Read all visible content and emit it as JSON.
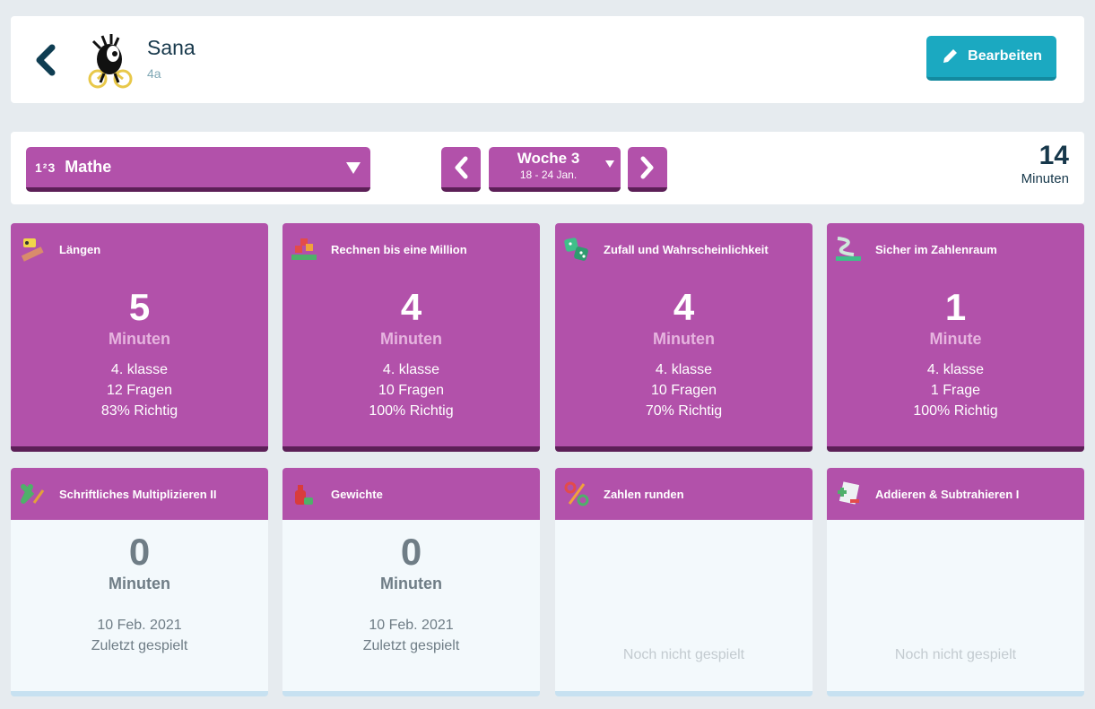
{
  "header": {
    "name": "Sana",
    "class": "4a",
    "edit_label": "Bearbeiten"
  },
  "filter": {
    "subject": "Mathe",
    "subject_icon_text": "1²3",
    "week_title": "Woche 3",
    "week_range": "18 - 24 Jan.",
    "total_minutes": "14",
    "total_unit": "Minuten"
  },
  "tiles_active": [
    {
      "title": "Längen",
      "minutes": "5",
      "unit": "Minuten",
      "grade": "4. klasse",
      "questions": "12 Fragen",
      "correct": "83% Richtig"
    },
    {
      "title": "Rechnen bis eine Million",
      "minutes": "4",
      "unit": "Minuten",
      "grade": "4. klasse",
      "questions": "10 Fragen",
      "correct": "100% Richtig"
    },
    {
      "title": "Zufall und Wahrscheinlichkeit",
      "minutes": "4",
      "unit": "Minuten",
      "grade": "4. klasse",
      "questions": "10 Fragen",
      "correct": "70% Richtig"
    },
    {
      "title": "Sicher im Zahlenraum",
      "minutes": "1",
      "unit": "Minute",
      "grade": "4. klasse",
      "questions": "1 Frage",
      "correct": "100% Richtig"
    }
  ],
  "tiles_inactive": [
    {
      "title": "Schriftliches Multiplizieren II",
      "minutes": "0",
      "unit": "Minuten",
      "date": "10 Feb. 2021",
      "status": "Zuletzt gespielt"
    },
    {
      "title": "Gewichte",
      "minutes": "0",
      "unit": "Minuten",
      "date": "10 Feb. 2021",
      "status": "Zuletzt gespielt"
    },
    {
      "title": "Zahlen runden",
      "status": "Noch nicht gespielt"
    },
    {
      "title": "Addieren & Subtrahieren I",
      "status": "Noch nicht gespielt"
    }
  ],
  "icons": {
    "back": "chevron-left-icon",
    "edit": "pencil-icon",
    "prev_week": "chevron-left-icon",
    "next_week": "chevron-right-icon",
    "dropdown": "caret-down-icon"
  },
  "colors": {
    "accent_purple": "#b251aa",
    "accent_dark_purple": "#5c1f57",
    "edit_button": "#1ba9c1",
    "text_dark": "#17384b"
  }
}
